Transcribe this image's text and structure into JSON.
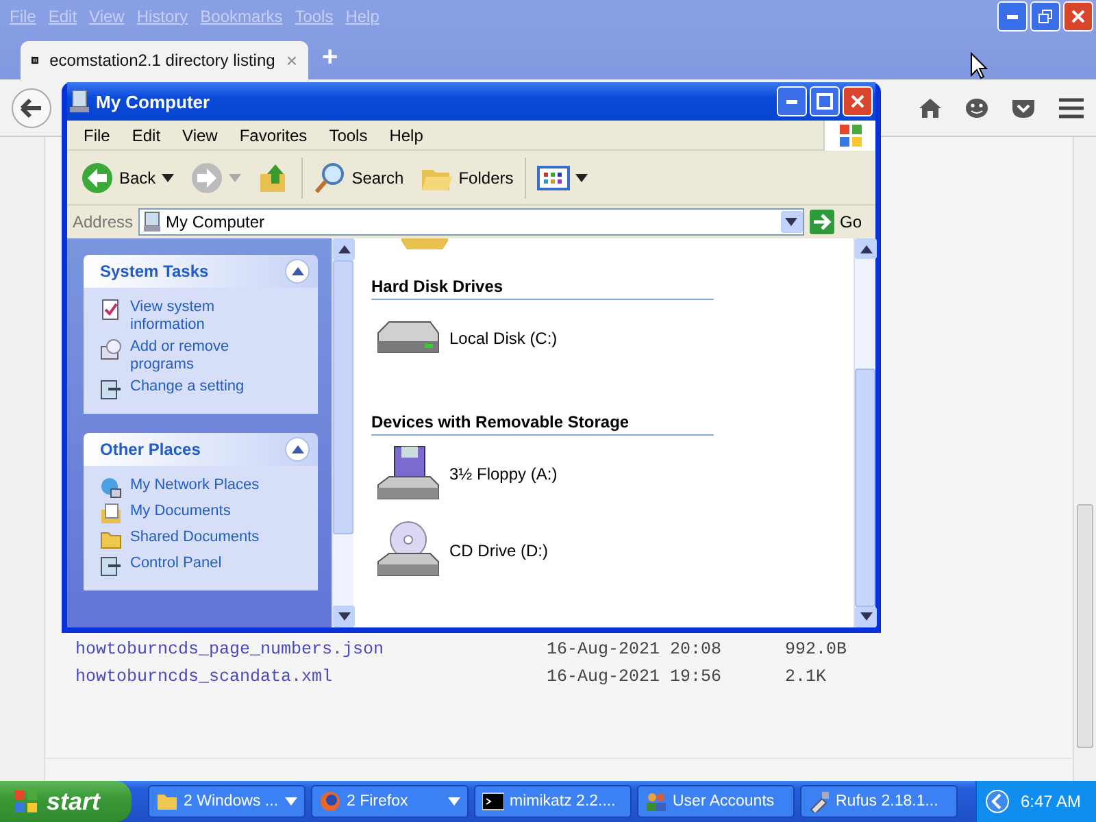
{
  "browser": {
    "menu": [
      "File",
      "Edit",
      "View",
      "History",
      "Bookmarks",
      "Tools",
      "Help"
    ],
    "tab": {
      "title": "ecomstation2.1 directory listing",
      "close": "×"
    },
    "new_tab": "+"
  },
  "listing": [
    {
      "name": "howtoburncds_page_numbers.json",
      "date": "16-Aug-2021 20:08",
      "size": "992.0B"
    },
    {
      "name": "howtoburncds_scandata.xml",
      "date": "16-Aug-2021 19:56",
      "size": "2.1K"
    }
  ],
  "explorer": {
    "title": "My Computer",
    "menu": [
      "File",
      "Edit",
      "View",
      "Favorites",
      "Tools",
      "Help"
    ],
    "toolbar": [
      {
        "kind": "back",
        "label": "Back"
      },
      {
        "kind": "forward"
      },
      {
        "kind": "up"
      },
      {
        "kind": "search",
        "label": "Search"
      },
      {
        "kind": "folders",
        "label": "Folders"
      },
      {
        "kind": "views"
      }
    ],
    "address": {
      "label": "Address",
      "value": "My Computer",
      "go": "Go"
    },
    "task_panels": [
      {
        "title": "System Tasks",
        "items": [
          {
            "kind": "info",
            "label": "View system information"
          },
          {
            "kind": "programs",
            "label": "Add or remove programs"
          },
          {
            "kind": "setting",
            "label": "Change a setting"
          }
        ]
      },
      {
        "title": "Other Places",
        "items": [
          {
            "kind": "network",
            "label": "My Network Places"
          },
          {
            "kind": "documents",
            "label": "My Documents"
          },
          {
            "kind": "folder",
            "label": "Shared Documents"
          },
          {
            "kind": "setting",
            "label": "Control Panel"
          }
        ]
      }
    ],
    "sections": [
      {
        "title": "Hard Disk Drives",
        "items": [
          {
            "kind": "disk",
            "label": "Local Disk (C:)"
          }
        ]
      },
      {
        "title": "Devices with Removable Storage",
        "items": [
          {
            "kind": "floppy",
            "label": "3½ Floppy (A:)"
          },
          {
            "kind": "cd",
            "label": "CD Drive (D:)"
          }
        ]
      }
    ]
  },
  "taskbar": {
    "start": "start",
    "buttons": [
      {
        "kind": "folder",
        "label": "2 Windows ...",
        "group": true
      },
      {
        "kind": "firefox",
        "label": "2 Firefox",
        "group": true
      },
      {
        "kind": "console",
        "label": "mimikatz 2.2....",
        "group": false
      },
      {
        "kind": "users",
        "label": "User Accounts",
        "group": false
      },
      {
        "kind": "rufus",
        "label": "Rufus 2.18.1...",
        "group": false
      }
    ],
    "clock": "6:47 AM"
  }
}
